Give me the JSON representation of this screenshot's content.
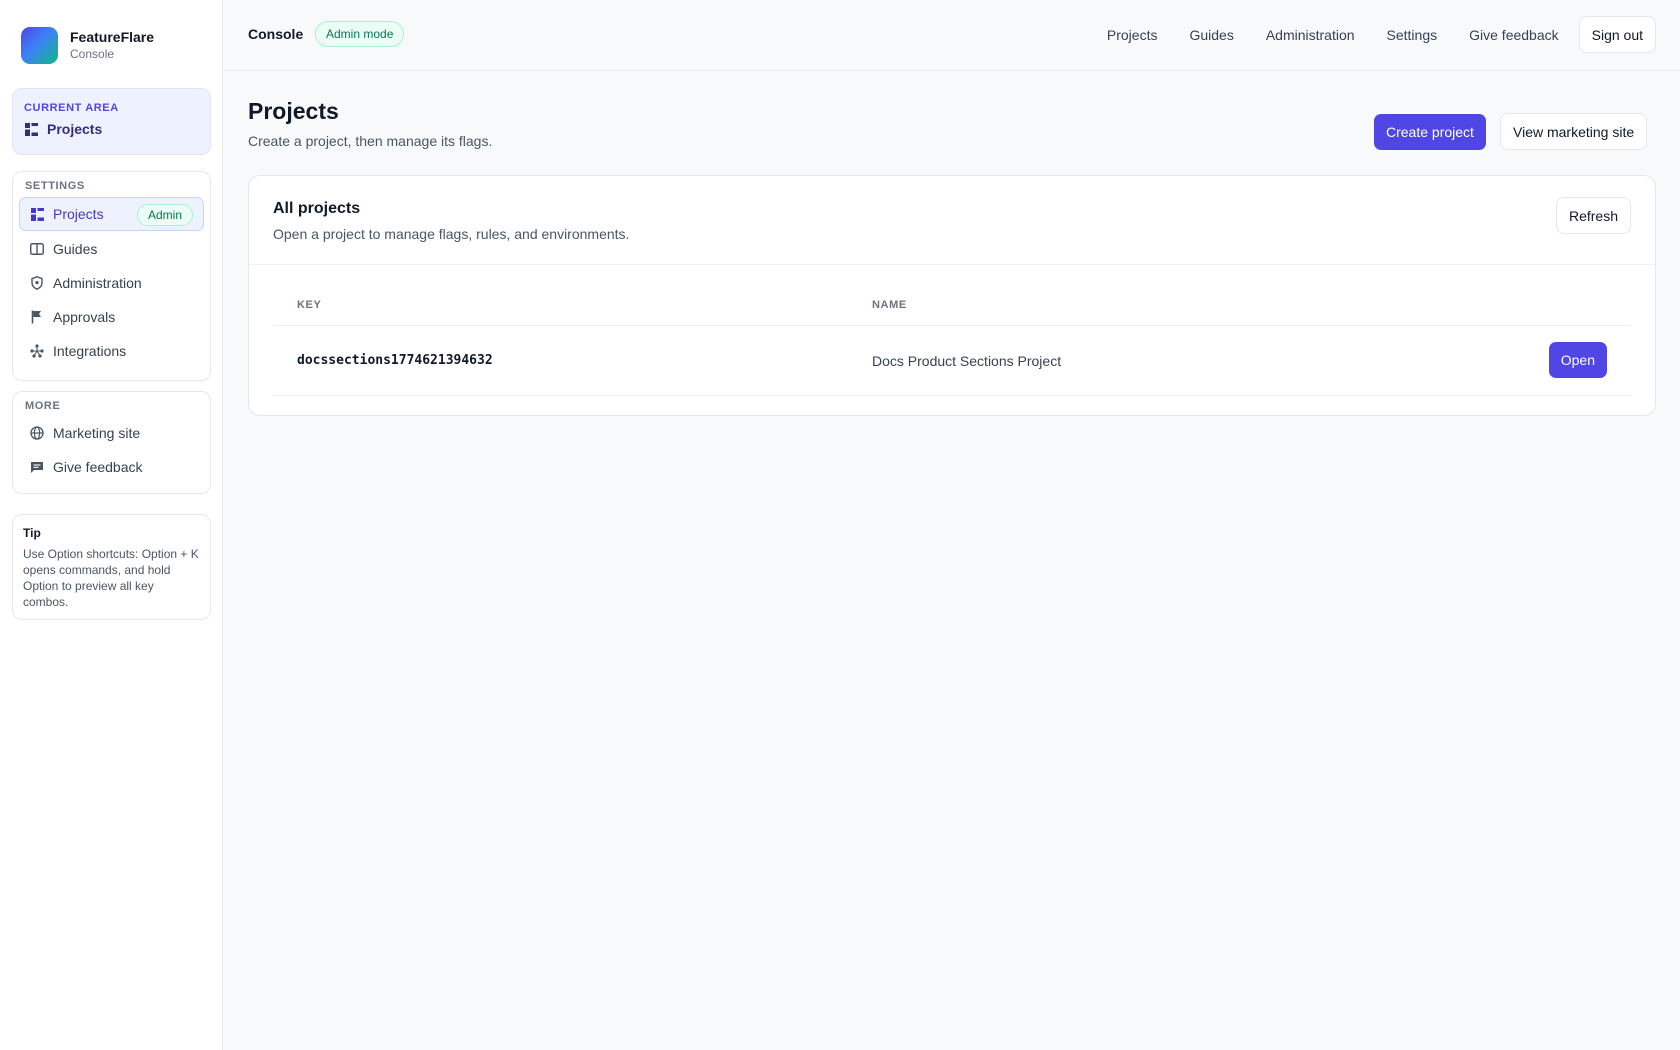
{
  "brand": {
    "name": "FeatureFlare",
    "subtitle": "Console"
  },
  "sidebar": {
    "current_area": {
      "label": "CURRENT AREA",
      "value": "Projects",
      "icon": "dashboard-icon"
    },
    "settings": {
      "title": "SETTINGS",
      "items": [
        {
          "label": "Projects",
          "icon": "dashboard-icon",
          "badge": "Admin",
          "active": true
        },
        {
          "label": "Guides",
          "icon": "book-icon"
        },
        {
          "label": "Administration",
          "icon": "shield-icon"
        },
        {
          "label": "Approvals",
          "icon": "flag-icon"
        },
        {
          "label": "Integrations",
          "icon": "integrations-icon"
        }
      ]
    },
    "more": {
      "title": "MORE",
      "items": [
        {
          "label": "Marketing site",
          "icon": "globe-icon"
        },
        {
          "label": "Give feedback",
          "icon": "chat-icon"
        }
      ]
    },
    "tip": {
      "title": "Tip",
      "body": "Use Option shortcuts: Option + K opens commands, and hold Option to preview all key combos."
    }
  },
  "topbar": {
    "title": "Console",
    "badge": "Admin mode",
    "links": [
      "Projects",
      "Guides",
      "Administration",
      "Settings",
      "Give feedback"
    ],
    "sign_out": "Sign out"
  },
  "header": {
    "title": "Projects",
    "subtitle": "Create a project, then manage its flags.",
    "create_button": "Create project",
    "marketing_button": "View marketing site"
  },
  "card": {
    "title": "All projects",
    "subtitle": "Open a project to manage flags, rules, and environments.",
    "refresh_button": "Refresh",
    "columns": {
      "key": "KEY",
      "name": "NAME"
    },
    "rows": [
      {
        "key": "docssections1774621394632",
        "name": "Docs Product Sections Project",
        "action": "Open"
      }
    ]
  },
  "colors": {
    "accent": "#4f46e5",
    "success_bg": "#ecfdf5",
    "success_text": "#047857"
  }
}
